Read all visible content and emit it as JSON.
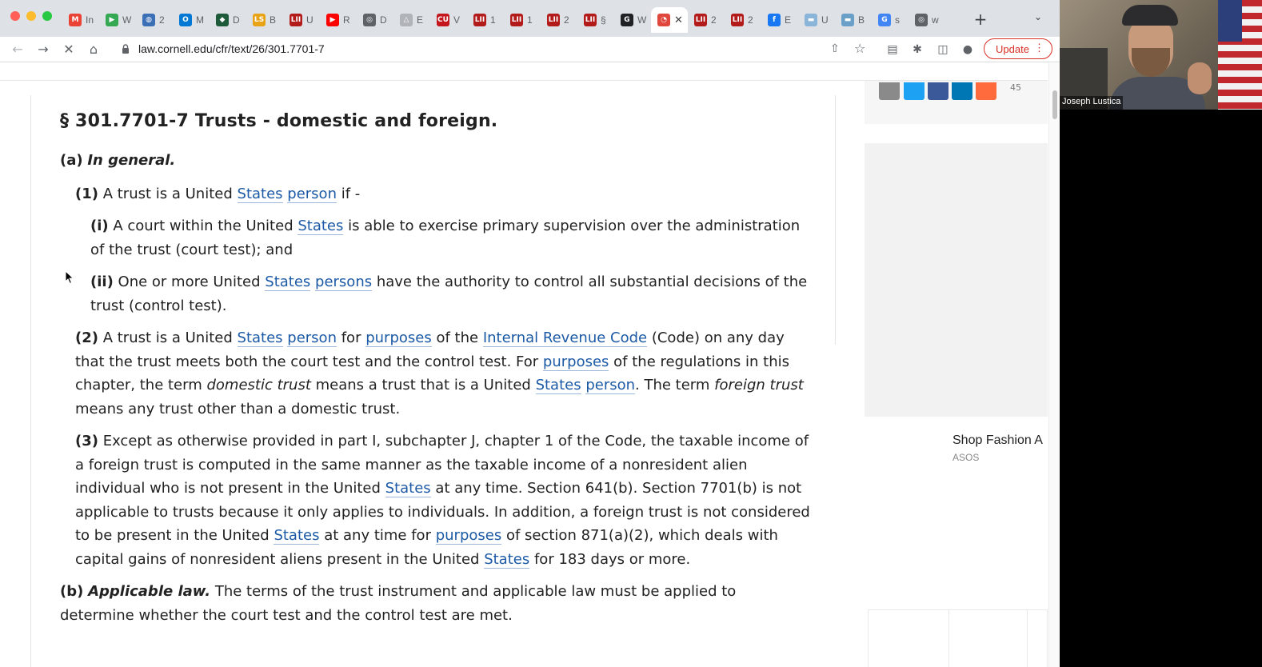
{
  "browser": {
    "tabs": [
      {
        "label": "In",
        "fav": "M",
        "color": "#ea4335"
      },
      {
        "label": "W",
        "fav": "▶",
        "color": "#34a853"
      },
      {
        "label": "2",
        "fav": "◍",
        "color": "#3b6fb6"
      },
      {
        "label": "M",
        "fav": "O",
        "color": "#0078d4"
      },
      {
        "label": "D",
        "fav": "◆",
        "color": "#1e5b3a"
      },
      {
        "label": "B",
        "fav": "LS",
        "color": "#e8a317"
      },
      {
        "label": "U",
        "fav": "LII",
        "color": "#b31b1b"
      },
      {
        "label": "R",
        "fav": "▶",
        "color": "#ff0000"
      },
      {
        "label": "D",
        "fav": "◎",
        "color": "#5f6368"
      },
      {
        "label": "E",
        "fav": "△",
        "color": "#b0b3b8"
      },
      {
        "label": "V",
        "fav": "CU",
        "color": "#c4161c"
      },
      {
        "label": "1",
        "fav": "LII",
        "color": "#b31b1b"
      },
      {
        "label": "1",
        "fav": "LII",
        "color": "#b31b1b"
      },
      {
        "label": "2",
        "fav": "LII",
        "color": "#b31b1b"
      },
      {
        "label": "§",
        "fav": "LII",
        "color": "#b31b1b"
      },
      {
        "label": "W",
        "fav": "G",
        "color": "#202124"
      },
      {
        "label": "",
        "fav": "◔",
        "color": "#e0483d",
        "active": true
      },
      {
        "label": "2",
        "fav": "LII",
        "color": "#b31b1b"
      },
      {
        "label": "2",
        "fav": "LII",
        "color": "#b31b1b"
      },
      {
        "label": "E",
        "fav": "f",
        "color": "#1877f2"
      },
      {
        "label": "U",
        "fav": "▬",
        "color": "#8ab4d8"
      },
      {
        "label": "B",
        "fav": "▬",
        "color": "#6aa0c8"
      },
      {
        "label": "s",
        "fav": "G",
        "color": "#4285f4"
      },
      {
        "label": "w",
        "fav": "◎",
        "color": "#5f6368"
      }
    ],
    "new_tab": "+",
    "url": "law.cornell.edu/cfr/text/26/301.7701-7",
    "update_label": "Update"
  },
  "article": {
    "title": "§ 301.7701-7 Trusts - domestic and foreign.",
    "a_marker": "(a)",
    "a_heading": "In general.",
    "p1_marker": "(1)",
    "p1_text1": "A trust is a United",
    "p1_link1": "States",
    "p1_link2": "person",
    "p1_text2": "if -",
    "pi_marker": "(i)",
    "pi_text1": "A court within the United",
    "pi_link1": "States",
    "pi_text2": "is able to exercise primary supervision over the administration of the trust (court test); and",
    "pii_marker": "(ii)",
    "pii_text1": "One or more United",
    "pii_link1": "States",
    "pii_link2": "persons",
    "pii_text2": "have the authority to control all substantial decisions of the trust (control test).",
    "p2_marker": "(2)",
    "p2_text1": "A trust is a United",
    "p2_link1": "States",
    "p2_link2": "person",
    "p2_text2": "for",
    "p2_link3": "purposes",
    "p2_text3": "of the",
    "p2_link4": "Internal Revenue Code",
    "p2_text4": "(Code) on any day that the trust meets both the court test and the control test. For",
    "p2_link5": "purposes",
    "p2_text5": "of the regulations in this chapter, the term",
    "p2_em1": "domestic trust",
    "p2_text6": "means a trust that is a United",
    "p2_link6": "States",
    "p2_link7": "person",
    "p2_text7": ". The term",
    "p2_em2": "foreign trust",
    "p2_text8": "means any trust other than a domestic trust.",
    "p3_marker": "(3)",
    "p3_text1": "Except as otherwise provided in part I, subchapter J, chapter 1 of the Code, the taxable income of a foreign trust is computed in the same manner as the taxable income of a nonresident alien individual who is not present in the United",
    "p3_link1": "States",
    "p3_text2": "at any time. Section 641(b). Section 7701(b) is not applicable to trusts because it only applies to individuals. In addition, a foreign trust is not considered to be present in the United",
    "p3_link2": "States",
    "p3_text3": "at any time for",
    "p3_link3": "purposes",
    "p3_text4": "of section 871(a)(2), which deals with capital gains of nonresident aliens present in the United",
    "p3_link4": "States",
    "p3_text5": "for 183 days or more.",
    "b_marker": "(b)",
    "b_heading": "Applicable law.",
    "b_text": "The terms of the trust instrument and applicable law must be applied to determine whether the court test and the control test are met."
  },
  "sidebar": {
    "share_count": "45",
    "ad_title": "Shop Fashion A",
    "ad_source": "ASOS"
  },
  "video": {
    "participant_name": "Joseph Lustica"
  }
}
